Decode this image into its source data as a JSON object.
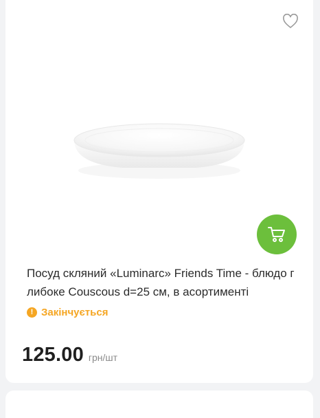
{
  "product": {
    "title": "Посуд скляний «Luminarc» Friends Time - блюдо глибоке Couscous d=25 см, в асортименті",
    "stock_status": "Закінчується",
    "stock_icon": "exclamation-icon",
    "price": "125.00",
    "unit": "грн/шт",
    "image_alt": "white-plate-image"
  },
  "actions": {
    "favorite_icon": "heart-icon",
    "cart_icon": "cart-icon"
  },
  "colors": {
    "accent_green": "#6cbf3c",
    "warning_orange": "#f5a623",
    "text_dark": "#2b2b2b",
    "text_muted": "#8a8a8a",
    "background": "#f2f3f5"
  }
}
